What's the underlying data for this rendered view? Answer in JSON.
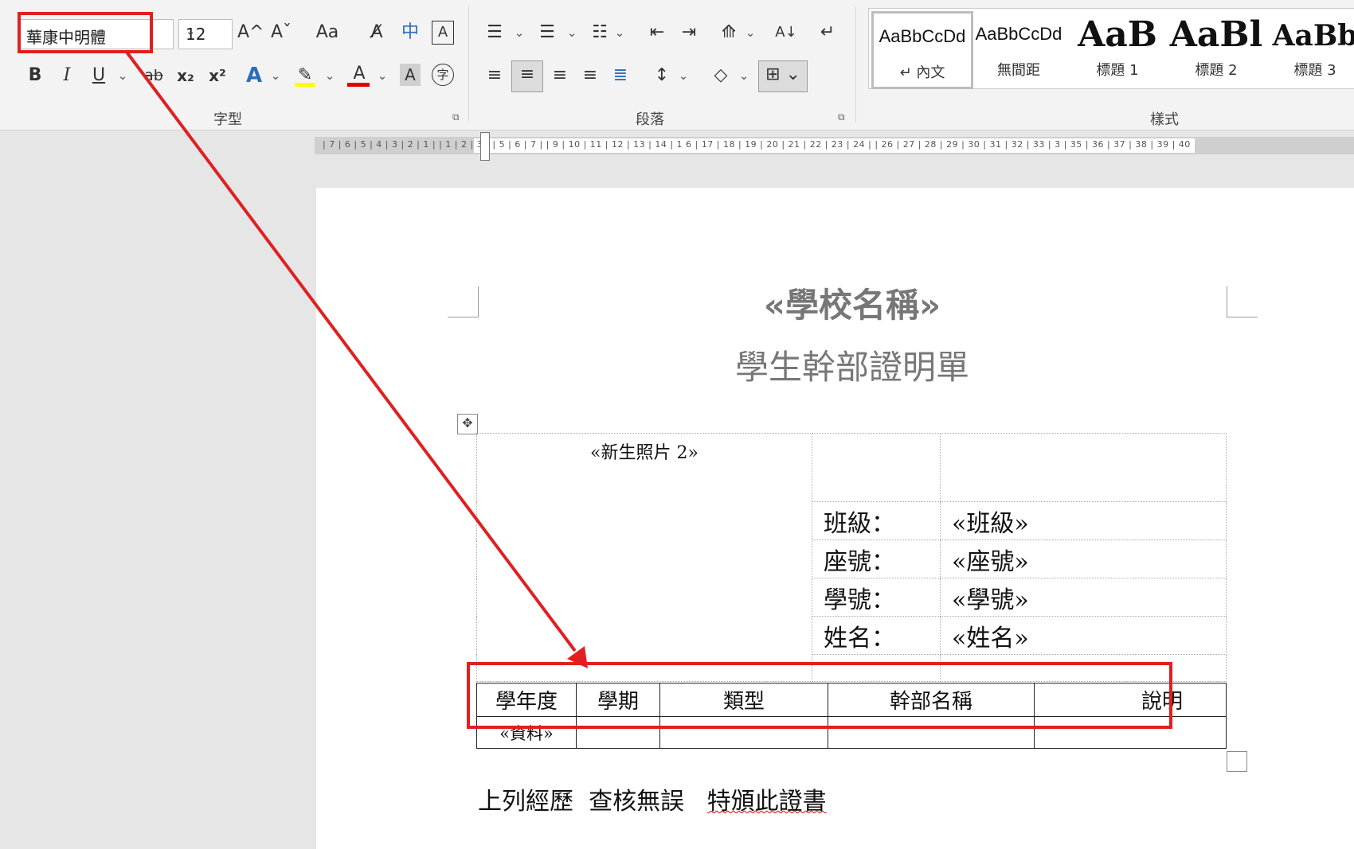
{
  "font_group": {
    "font_name": "華康中明體",
    "font_size": "12",
    "label": "字型",
    "bold": "B",
    "italic": "I",
    "underline": "U",
    "strike": "ab",
    "subscript": "x₂",
    "superscript": "x²",
    "grow": "A^",
    "shrink": "Aˇ",
    "change_case": "Aa",
    "phonetic": "中",
    "enclose": "字"
  },
  "paragraph_group": {
    "label": "段落"
  },
  "styles_group": {
    "label": "樣式",
    "items": [
      {
        "sample": "AaBbCcDd",
        "name": "↵ 內文"
      },
      {
        "sample": "AaBbCcDd",
        "name": "無間距"
      },
      {
        "sample": "AaB",
        "name": "標題 1"
      },
      {
        "sample": "AaBl",
        "name": "標題 2"
      },
      {
        "sample": "AaBb",
        "name": "標題 3"
      }
    ]
  },
  "ruler": {
    "ticks": "| 7 | 6 | 5 | 4 | 3 | 2 | 1 |   | 1 | 2 | 3 |   | 5 | 6 | 7 |   | 9 | 10 | 11 | 12 | 13 | 14 | 1   6 | 17 | 18 | 19 | 20 | 21 | 22 | 23 | 24 |   | 26 | 27 | 28 | 29 | 30 | 31 | 32 | 33 | 3 | 35 | 36 | 37 | 38 | 39 | 40"
  },
  "document": {
    "school_name": "«學校名稱»",
    "doc_title": "學生幹部證明單",
    "photo_field": "«新生照片 2»",
    "info_rows": [
      {
        "label": "班級：",
        "value": "«班級»"
      },
      {
        "label": "座號：",
        "value": "«座號»"
      },
      {
        "label": "學號：",
        "value": "«學號»"
      },
      {
        "label": "姓名：",
        "value": "«姓名»"
      }
    ],
    "table_headers": [
      "學年度",
      "學期",
      "類型",
      "幹部名稱",
      "說明"
    ],
    "table_first_cell": "«資料»",
    "footer_a": "上列經歷  查核無誤   ",
    "footer_b": "特頒此證書"
  },
  "colors": {
    "annotation": "#e02020"
  }
}
